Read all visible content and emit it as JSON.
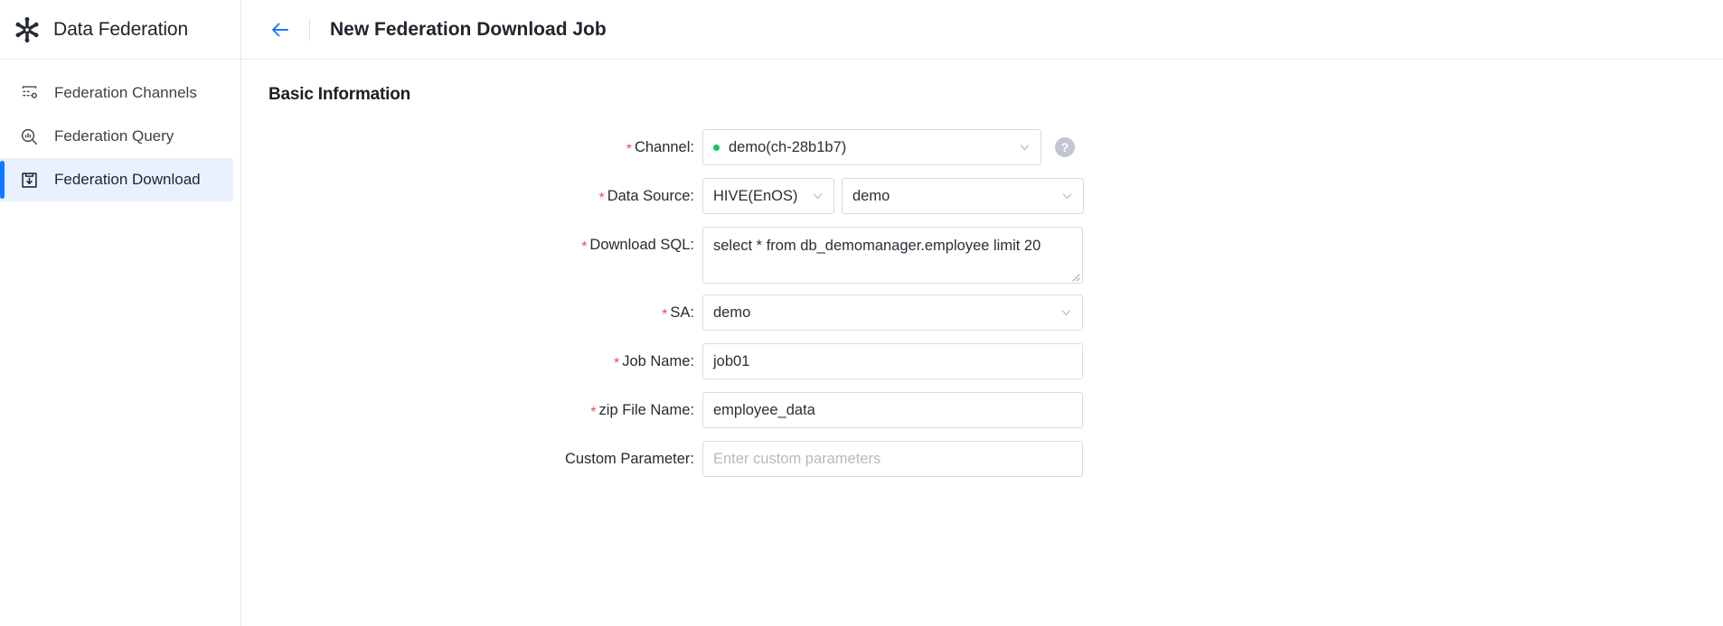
{
  "brand": {
    "title": "Data Federation",
    "logo_icon": "snowflake-logo-icon"
  },
  "sidebar": {
    "items": [
      {
        "label": "Federation Channels",
        "icon": "federation-channels-icon",
        "active": false
      },
      {
        "label": "Federation Query",
        "icon": "federation-query-icon",
        "active": false
      },
      {
        "label": "Federation Download",
        "icon": "federation-download-icon",
        "active": true
      }
    ]
  },
  "header": {
    "back_icon": "back-arrow-icon",
    "title": "New Federation Download Job"
  },
  "form": {
    "section_title": "Basic Information",
    "channel": {
      "label": "Channel",
      "required": true,
      "value": "demo(ch-28b1b7)",
      "status_color": "#18bf63",
      "caret_icon": "chevron-down-icon",
      "help_icon": "question-mark-icon",
      "help_label": "?"
    },
    "data_source": {
      "label": "Data Source",
      "required": true,
      "type_value": "HIVE(EnOS)",
      "name_value": "demo",
      "caret_icon": "chevron-down-icon"
    },
    "download_sql": {
      "label": "Download SQL",
      "required": true,
      "value": "select * from db_demomanager.employee limit 20",
      "resize_icon": "resize-grip-icon"
    },
    "sa": {
      "label": "SA",
      "required": true,
      "value": "demo",
      "caret_icon": "chevron-down-icon"
    },
    "job_name": {
      "label": "Job Name",
      "required": true,
      "value": "job01"
    },
    "zip_file_name": {
      "label": "zip File Name",
      "required": true,
      "value": "employee_data"
    },
    "custom_parameter": {
      "label": "Custom Parameter",
      "required": false,
      "value": "",
      "placeholder": "Enter custom parameters"
    }
  },
  "colors": {
    "accent": "#1677ff",
    "active_bg": "#eaf1fe",
    "required_mark": "#f04c4c",
    "status_green": "#18bf63",
    "border": "#d9dade"
  },
  "symbols": {
    "required_mark": "*",
    "colon": ":"
  }
}
